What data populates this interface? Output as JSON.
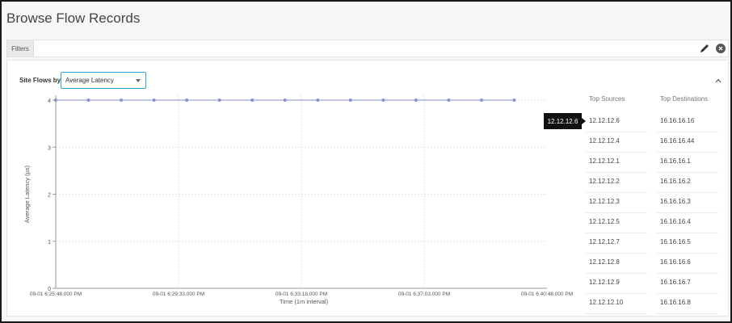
{
  "page": {
    "title": "Browse Flow Records"
  },
  "filter_bar": {
    "filters_label": "Filters",
    "icons": [
      "edit-icon",
      "clear-icon"
    ]
  },
  "panel": {
    "site_flows_label": "Site Flows by:",
    "select_value": "Average Latency",
    "tooltip": "12.12.12.6",
    "top_sources": {
      "header": "Top Sources",
      "items": [
        "12.12.12.6",
        "12.12.12.4",
        "12.12.12.1",
        "12.12.12.2",
        "12.12.12.3",
        "12.12.12.5",
        "12.12.12.7",
        "12.12.12.8",
        "12.12.12.9",
        "12.12.12.10"
      ]
    },
    "top_destinations": {
      "header": "Top Destinations",
      "items": [
        "16.16.16.16",
        "16.16.16.44",
        "16.16.16.1",
        "16.16.16.2",
        "16.16.16.3",
        "16.16.16.4",
        "16.16.16.5",
        "16.16.16.6",
        "16.16.16.7",
        "16.16.16.8"
      ]
    }
  },
  "chart_data": {
    "type": "line",
    "xlabel": "Time (1m interval)",
    "ylabel": "Average Latency (µs)",
    "y_ticks": [
      "0",
      "1",
      "2",
      "3",
      "4"
    ],
    "ylim": [
      0,
      4
    ],
    "x_tick_labels": [
      "09-01 6:25:48.000 PM",
      "09-01 6:29:33.000 PM",
      "09-01 6:33:18.000 PM",
      "09-01 6:37:03.000 PM",
      "09-01 6:40:48.000 PM"
    ],
    "x_minutes": [
      0,
      1,
      2,
      3,
      4,
      5,
      6,
      7,
      8,
      9,
      10,
      11,
      12,
      13,
      14
    ],
    "x_range_minutes": [
      0,
      15
    ],
    "grid": true,
    "series": [
      {
        "values": [
          4,
          4,
          4,
          4,
          4,
          4,
          4,
          4,
          4,
          4,
          4,
          4,
          4,
          4,
          4
        ],
        "color": "#8a8fd1"
      }
    ]
  }
}
